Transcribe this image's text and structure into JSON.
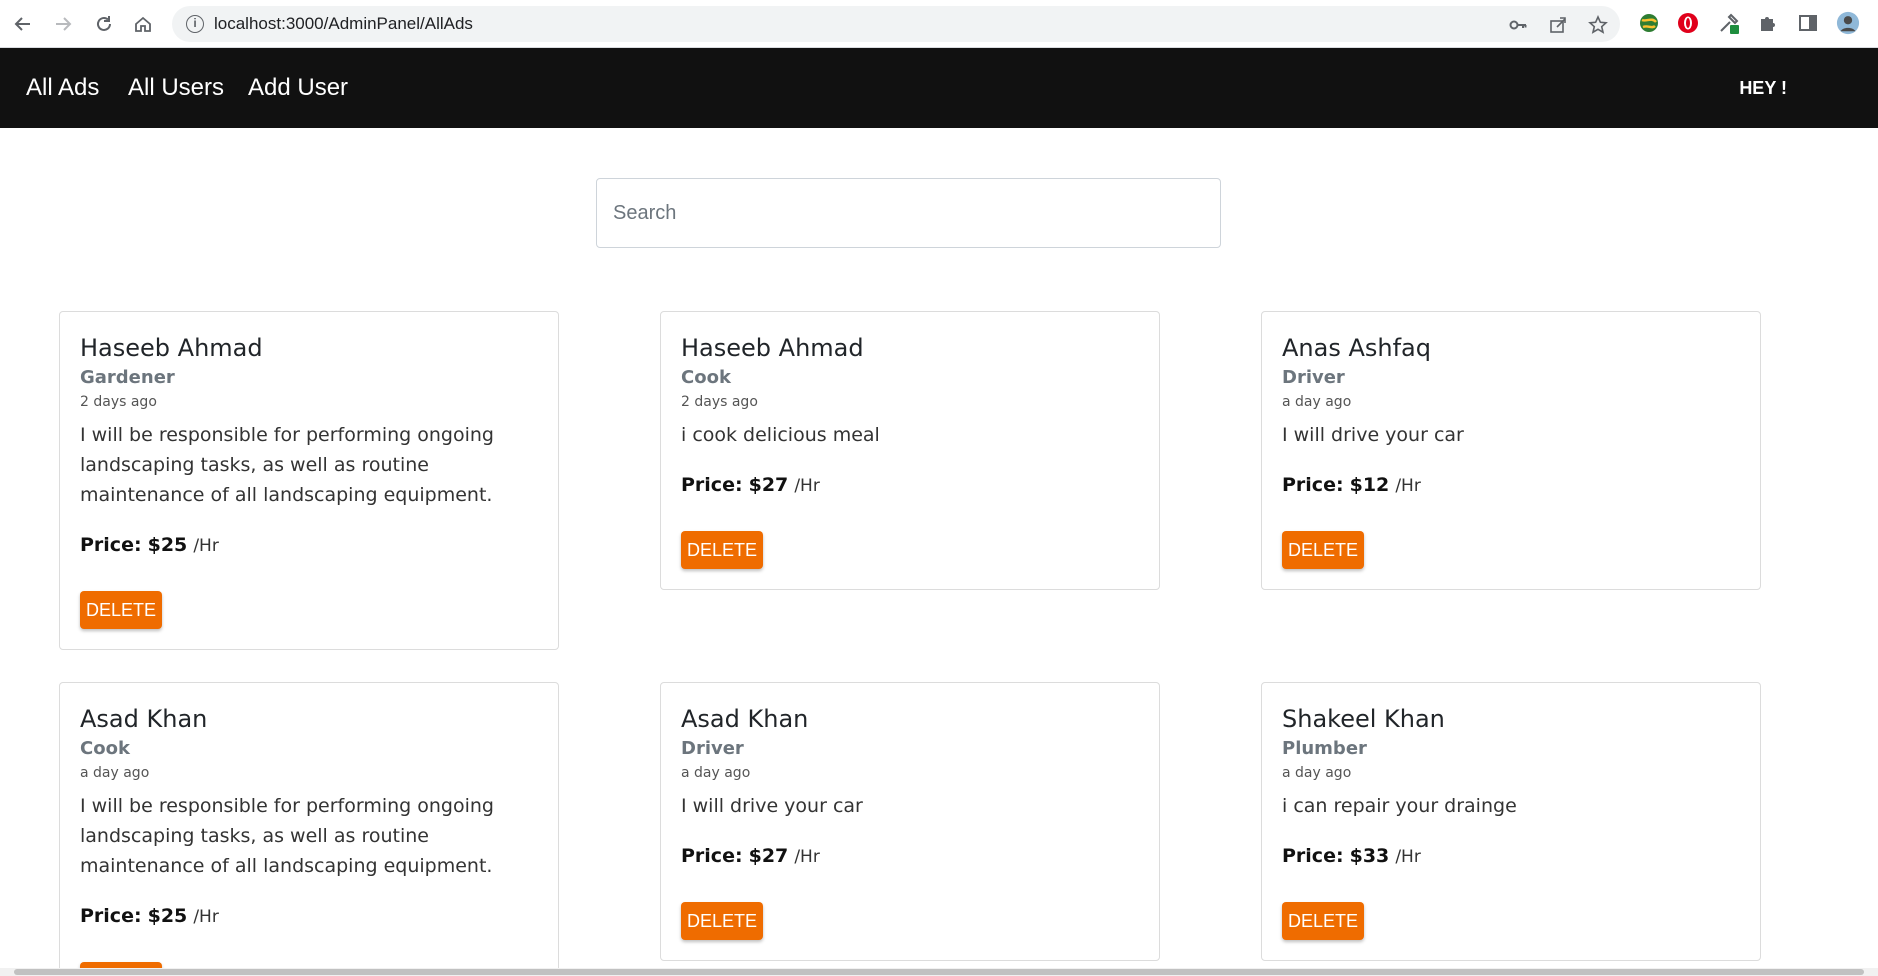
{
  "browser": {
    "url": "localhost:3000/AdminPanel/AllAds",
    "icons": [
      "back-arrow-icon",
      "forward-arrow-icon",
      "reload-icon",
      "home-icon",
      "site-info-icon",
      "key-icon",
      "share-icon",
      "bookmark-star-icon",
      "globe-extension-icon",
      "opera-extension-icon",
      "eyedropper-extension-icon",
      "puzzle-extensions-icon",
      "side-panel-icon",
      "profile-avatar-icon"
    ]
  },
  "nav": {
    "links": [
      "All Ads",
      "All Users",
      "Add User"
    ],
    "greeting": "HEY !"
  },
  "search": {
    "placeholder": "Search",
    "value": ""
  },
  "ads": [
    {
      "name": "Haseeb Ahmad",
      "category": "Gardener",
      "time": "2 days ago",
      "description": "I will be responsible for performing ongoing landscaping tasks, as well as routine maintenance of all landscaping equipment.",
      "price_label": "Price:",
      "price": "$25",
      "unit": "/Hr",
      "action": "DELETE"
    },
    {
      "name": "Haseeb Ahmad",
      "category": "Cook",
      "time": "2 days ago",
      "description": "i cook delicious meal",
      "price_label": "Price:",
      "price": "$27",
      "unit": "/Hr",
      "action": "DELETE"
    },
    {
      "name": "Anas Ashfaq",
      "category": "Driver",
      "time": "a day ago",
      "description": "I will drive your car",
      "price_label": "Price:",
      "price": "$12",
      "unit": "/Hr",
      "action": "DELETE"
    },
    {
      "name": "Asad Khan",
      "category": "Cook",
      "time": "a day ago",
      "description": "I will be responsible for performing ongoing landscaping tasks, as well as routine maintenance of all landscaping equipment.",
      "price_label": "Price:",
      "price": "$25",
      "unit": "/Hr",
      "action": "DELETE"
    },
    {
      "name": "Asad Khan",
      "category": "Driver",
      "time": "a day ago",
      "description": "I will drive your car",
      "price_label": "Price:",
      "price": "$27",
      "unit": "/Hr",
      "action": "DELETE"
    },
    {
      "name": "Shakeel Khan",
      "category": "Plumber",
      "time": "a day ago",
      "description": "i can repair your drainge",
      "price_label": "Price:",
      "price": "$33",
      "unit": "/Hr",
      "action": "DELETE"
    }
  ],
  "colors": {
    "navbar": "#111111",
    "delete_button": "#ef6c00",
    "category_text": "#6c757d"
  }
}
